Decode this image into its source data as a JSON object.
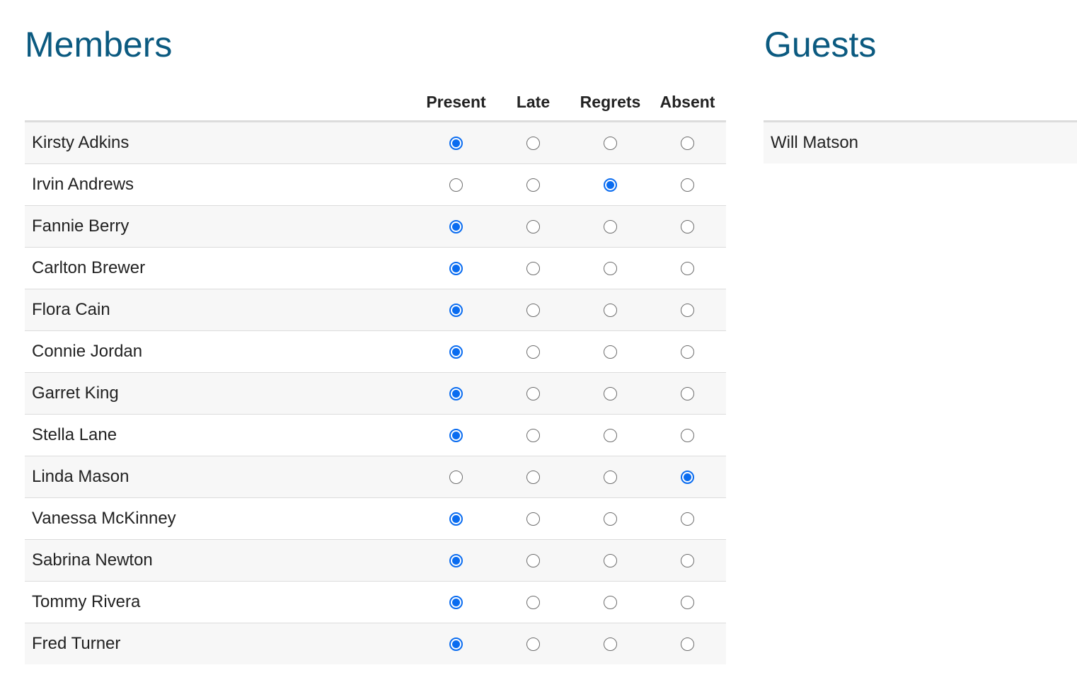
{
  "members": {
    "title": "Members",
    "columns": [
      "Present",
      "Late",
      "Regrets",
      "Absent"
    ],
    "rows": [
      {
        "name": "Kirsty Adkins",
        "status": "Present"
      },
      {
        "name": "Irvin Andrews",
        "status": "Regrets"
      },
      {
        "name": "Fannie Berry",
        "status": "Present"
      },
      {
        "name": "Carlton Brewer",
        "status": "Present"
      },
      {
        "name": "Flora Cain",
        "status": "Present"
      },
      {
        "name": "Connie Jordan",
        "status": "Present"
      },
      {
        "name": "Garret King",
        "status": "Present"
      },
      {
        "name": "Stella Lane",
        "status": "Present"
      },
      {
        "name": "Linda Mason",
        "status": "Absent"
      },
      {
        "name": "Vanessa McKinney",
        "status": "Present"
      },
      {
        "name": "Sabrina Newton",
        "status": "Present"
      },
      {
        "name": "Tommy Rivera",
        "status": "Present"
      },
      {
        "name": "Fred Turner",
        "status": "Present"
      }
    ]
  },
  "guests": {
    "title": "Guests",
    "rows": [
      {
        "name": "Will Matson"
      }
    ]
  },
  "colors": {
    "title": "#0b5a80",
    "radio_selected": "#0a6cf0",
    "row_stripe": "#f7f7f7",
    "divider": "#dcdcdc"
  }
}
